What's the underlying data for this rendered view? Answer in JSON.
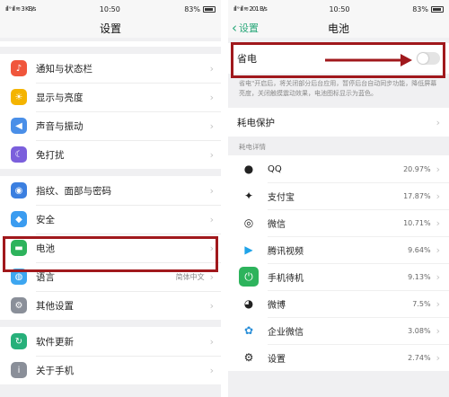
{
  "left": {
    "status": {
      "left": "ıll ᵊ ıll ≋ 3 KB/s",
      "time": "10:50",
      "battery": "83%"
    },
    "title": "设置",
    "groups": [
      [
        {
          "label": "通知与状态栏",
          "icon": "bell-icon",
          "color": "#f0563c"
        },
        {
          "label": "显示与亮度",
          "icon": "sun-icon",
          "color": "#f4b400"
        },
        {
          "label": "声音与振动",
          "icon": "speaker-icon",
          "color": "#4a8fe8"
        },
        {
          "label": "免打扰",
          "icon": "moon-icon",
          "color": "#7b5fdc"
        }
      ],
      [
        {
          "label": "指纹、面部与密码",
          "icon": "fingerprint-icon",
          "color": "#3b7fe0"
        },
        {
          "label": "安全",
          "icon": "shield-icon",
          "color": "#3b9cf0"
        },
        {
          "label": "电池",
          "icon": "battery-icon",
          "color": "#2db35c"
        },
        {
          "label": "语言",
          "icon": "globe-icon",
          "color": "#3da6f0",
          "value": "简体中文"
        },
        {
          "label": "其他设置",
          "icon": "gear-icon",
          "color": "#8a8f99"
        }
      ],
      [
        {
          "label": "软件更新",
          "icon": "refresh-icon",
          "color": "#27b07a"
        },
        {
          "label": "关于手机",
          "icon": "info-icon",
          "color": "#8a8f99"
        }
      ]
    ]
  },
  "right": {
    "status": {
      "left": "ıll ᵊ ıll ≋ 201 B/s",
      "time": "10:50",
      "battery": "83%"
    },
    "back_label": "设置",
    "title": "电池",
    "power_save_label": "省电",
    "power_save_on": false,
    "description": "省电\"开启后，将关闭部分后台应用，暂停后台自动同步功能，降低屏幕亮度，关闭触摸震动效果，电池图标显示为蓝色。",
    "protection_label": "耗电保护",
    "details_header": "耗电详情",
    "apps": [
      {
        "name": "QQ",
        "pct": "20.97%",
        "icon": "qq-icon",
        "color": "#222"
      },
      {
        "name": "支付宝",
        "pct": "17.87%",
        "icon": "alipay-icon",
        "color": "#222"
      },
      {
        "name": "微信",
        "pct": "10.71%",
        "icon": "wechat-icon",
        "color": "#222"
      },
      {
        "name": "腾讯视频",
        "pct": "9.64%",
        "icon": "tencent-video-icon",
        "color": "#1fa3e8"
      },
      {
        "name": "手机待机",
        "pct": "9.13%",
        "icon": "power-icon",
        "color": "#2db35c"
      },
      {
        "name": "微博",
        "pct": "7.5%",
        "icon": "weibo-icon",
        "color": "#222"
      },
      {
        "name": "企业微信",
        "pct": "3.08%",
        "icon": "wecom-icon",
        "color": "#2a8fd8"
      },
      {
        "name": "设置",
        "pct": "2.74%",
        "icon": "gear-icon",
        "color": "#222"
      }
    ]
  },
  "colors": {
    "accent": "#2aa87a",
    "highlight": "#a0181c"
  }
}
